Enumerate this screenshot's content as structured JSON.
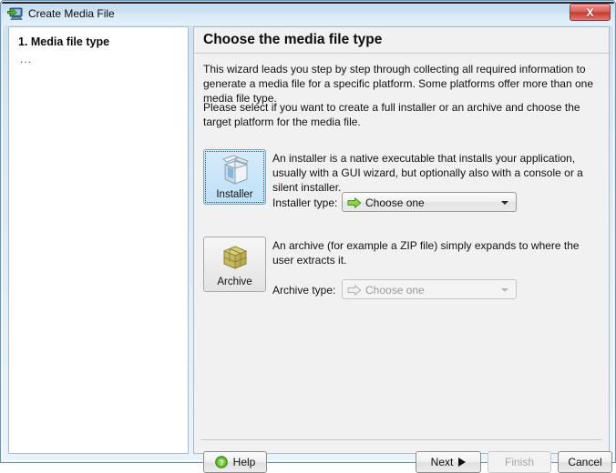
{
  "window": {
    "title": "Create Media File",
    "title_icon": "media-file-monitor-icon",
    "close_label": "X",
    "frame_color": "#6f93b3",
    "titlebar_color": "#cde1f2",
    "close_button_color": "#c13b32"
  },
  "sidebar": {
    "steps": [
      {
        "label": "1. Media file type",
        "active": true
      },
      {
        "label": "...",
        "active": false
      }
    ]
  },
  "content": {
    "heading": "Choose the media file type",
    "paragraphs": [
      "This wizard leads you step by step through collecting all required information to generate a media file for a specific platform. Some platforms offer more than one media file type.",
      "Please select if you want to create a full installer or an archive and choose the target platform for the media file."
    ],
    "options": [
      {
        "id": "installer",
        "tile_label": "Installer",
        "tile_icon": "installer-box-icon",
        "selected": true,
        "description": "An installer is a native executable that installs your application, usually with a GUI wizard, but optionally also with a console or a silent installer.",
        "type_label": "Installer type:",
        "combo": {
          "value": "Choose one",
          "icon": "green-arrow-icon",
          "disabled": false,
          "accent_color": "#7dc242"
        }
      },
      {
        "id": "archive",
        "tile_label": "Archive",
        "tile_icon": "archive-package-icon",
        "selected": false,
        "description": "An archive (for example a ZIP file) simply expands to where the user extracts it.",
        "type_label": "Archive type:",
        "combo": {
          "value": "Choose one",
          "icon": "gray-arrow-icon",
          "disabled": true,
          "accent_color": "#b5b5b5"
        }
      }
    ]
  },
  "footer": {
    "help_label": "Help",
    "help_icon": "green-question-mark-icon",
    "next_label": "Next",
    "next_icon": "right-triangle-icon",
    "finish_label": "Finish",
    "finish_disabled": true,
    "cancel_label": "Cancel"
  }
}
